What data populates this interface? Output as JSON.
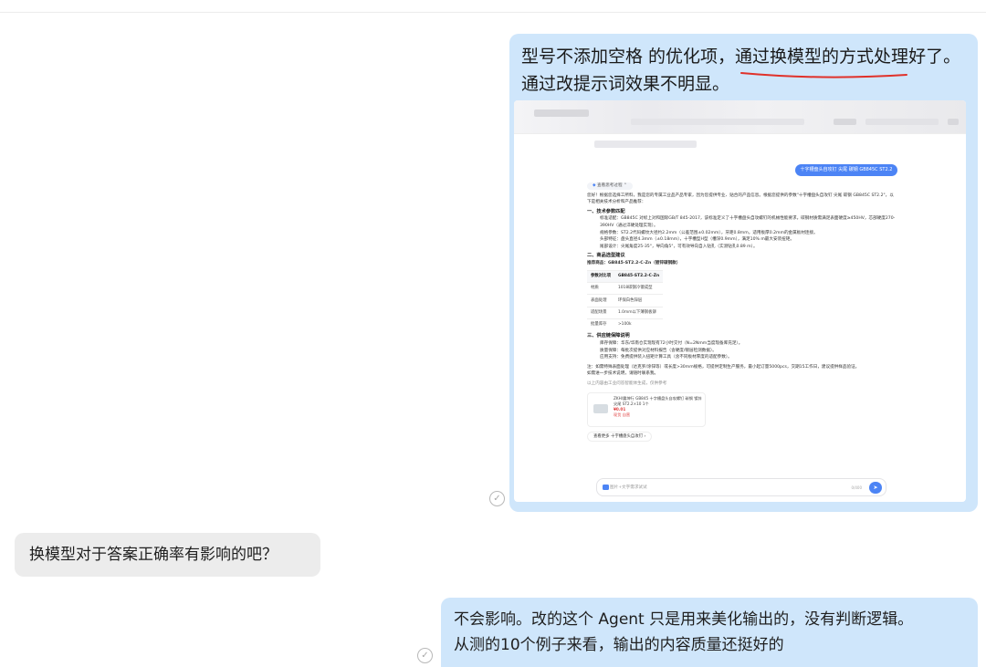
{
  "messages": [
    {
      "role": "outgoing",
      "line1_a": "型号不添加空格 的优化项，",
      "line1_b": "通过换模型的方式处理",
      "line1_c": "好了。",
      "line2": "通过改提示词效果不明显。",
      "highlight_color": "#e0312a"
    },
    {
      "role": "incoming",
      "text": "换模型对于答案正确率有影响的吧？"
    },
    {
      "role": "outgoing",
      "line1": "不会影响。改的这个 Agent 只是用来美化输出的，没有判断逻辑。",
      "line2": "从测的10个例子来看，输出的内容质量还挺好的"
    }
  ],
  "screenshot": {
    "question": "十字槽盘头自攻钉 尖尾 碳钢 GB845C ST2.2",
    "thinking_label": "查看思考过程",
    "intro": "您好！根据您选择工所料，我是您的专属工业品产品专家，因为您提供专业、贴合的产品信息。根据您提供的参数\"十字槽盘头自攻钉 尖尾 碳钢 GB845C ST2.2\"，以下是相关技术分析和产品推荐：",
    "section1": "一、技术参数匹配",
    "s1_items": [
      "标准适配：GB845C 对标上对和国际GB/T 845-2017，该标准定义了十字槽盘头自攻螺钉的机械性能要求，碳钢材质需满足表面硬度≥450HV，芯部硬度270-390HV（通过淬硬处理实现）。",
      "规格参数：ST2.2代码螺纹大径约2.2mm（公差范围±0.02mm），牙距0.8mm，适用板厚0.2mm的金属板材连接。",
      "头部特征：盘头直径4.3mm（±0.18mm），十字槽型H型（槽深0.9mm），满足10% m最大安装扭矩。",
      "尾部设计：尖尾角度25-35°，导向角5°，可有效导向自入钻孔（实测钻孔0.89 m）。"
    ],
    "section2": "二、商品选型建议",
    "recommend": "推荐商品：GB845-ST2.2-C-Zn（镀锌碳钢款）",
    "table_rows": [
      [
        "参数对比项",
        "GB845-ST2.2-C-Zn"
      ],
      [
        "材质",
        "1018碳钢冷镦成型"
      ],
      [
        "表面处理",
        "环保白色锌层"
      ],
      [
        "适配场景",
        "1.0mm以下薄钢板铆"
      ],
      [
        "批量库存",
        ">100k"
      ]
    ],
    "section3": "三、供应链保障说明",
    "s3_items": [
      "库存保障：华东/华南仓实现现有72小时交付（N=2Nmm当度现备库充足）。",
      "质量保障：每批次提供对应材料报告（含硬度/镀层检测数据）。",
      "应用支持：免费提供装入扭矩计算工具（含不同板材厚度的适配参数）。"
    ],
    "note": "注：如需特殊表面处理（达克罗/涂锌等）或长度>30mm规格，可提供定制生产服务，最小起订量5000pcs，交期15工作日，建议提供样品验证。",
    "note2": "如需进一步技术说明，请随时联系我。",
    "disclaimer": "以上内容由工业问答智能体生成，仅供参考",
    "product_text": "ZKH/震坤行 GB845 十字槽盘头自攻螺钉 碳钢 镀锌 尖尾 ST2.2×10 1个",
    "product_price": "¥0.01",
    "product_tag": "现货 自营",
    "more_btn": "查看更多 十字槽盘头自攻钉 ›",
    "input_placeholder": "图片+文字需求试试",
    "input_counter": "0/400"
  }
}
